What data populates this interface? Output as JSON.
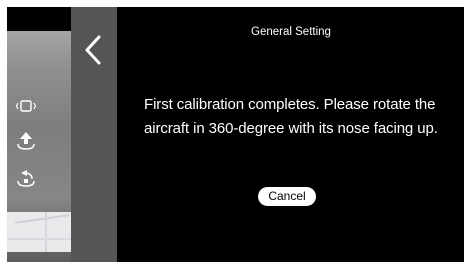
{
  "dialog": {
    "title": "General Setting",
    "message": "First calibration completes. Please rotate the aircraft in 360-degree with its nose facing up.",
    "cancel_label": "Cancel"
  },
  "sidebar": {
    "icons": [
      "vibration-icon",
      "takeoff-icon",
      "return-home-icon"
    ]
  },
  "colors": {
    "dialog_bg": "#000000",
    "back_panel": "#555555",
    "button_bg": "#ffffff"
  }
}
